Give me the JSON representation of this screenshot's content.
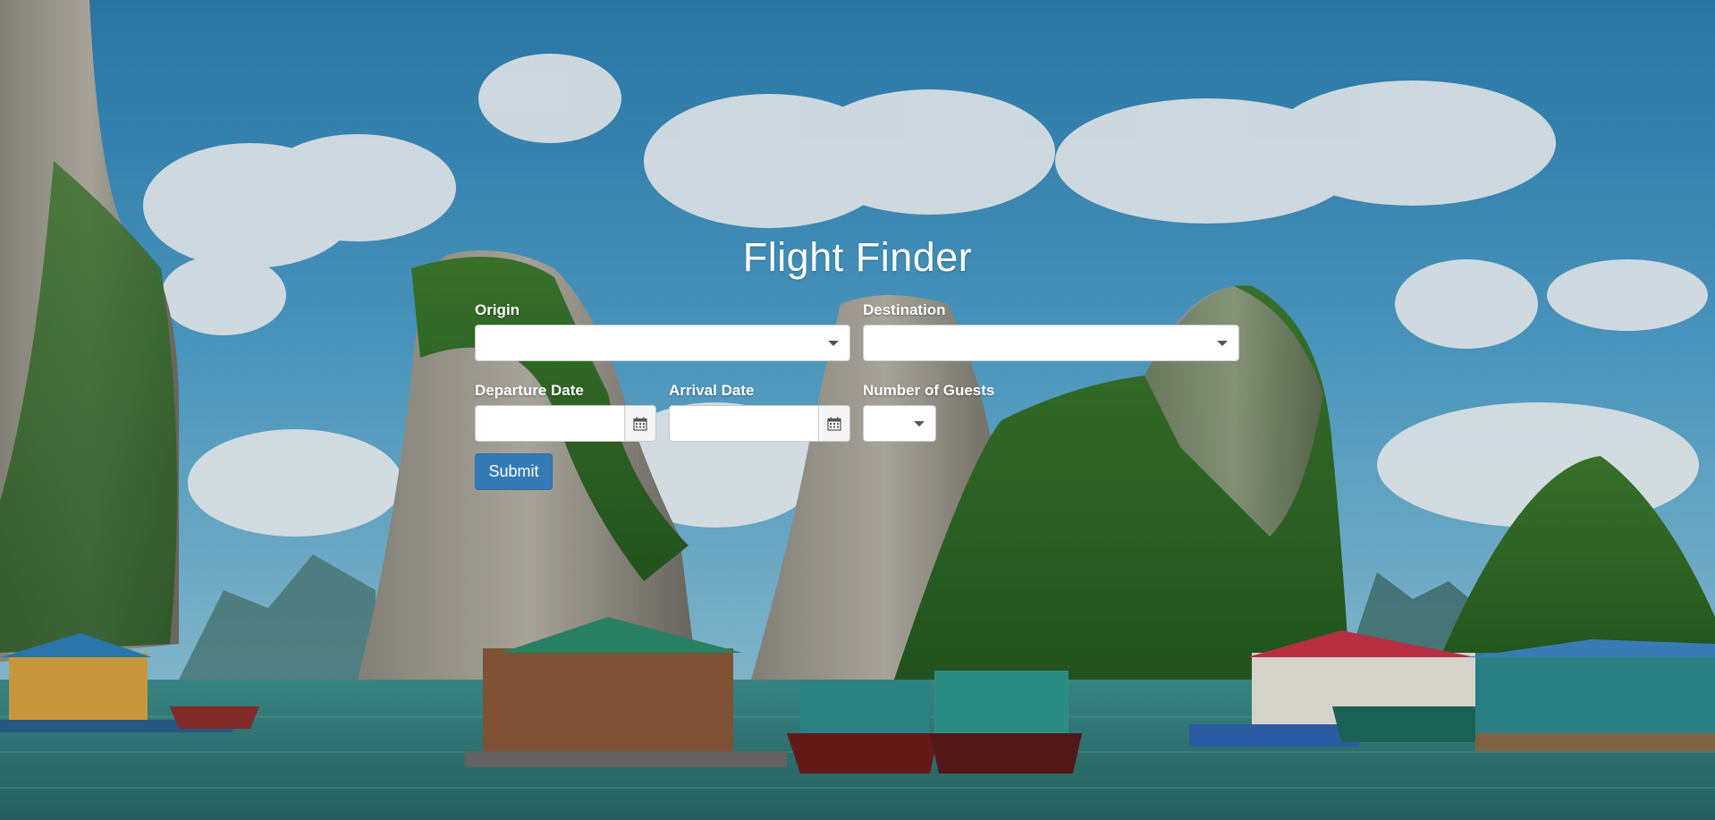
{
  "page": {
    "title": "Flight Finder"
  },
  "form": {
    "origin": {
      "label": "Origin",
      "value": ""
    },
    "destination": {
      "label": "Destination",
      "value": ""
    },
    "departure_date": {
      "label": "Departure Date",
      "value": ""
    },
    "arrival_date": {
      "label": "Arrival Date",
      "value": ""
    },
    "guests": {
      "label": "Number of Guests",
      "value": ""
    },
    "submit_label": "Submit"
  },
  "colors": {
    "primary_button": "#337ab7",
    "label_text": "#ffffff"
  },
  "icons": [
    "calendar-icon",
    "chevron-down-icon"
  ]
}
